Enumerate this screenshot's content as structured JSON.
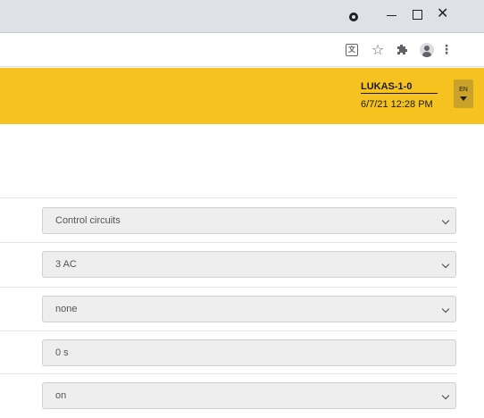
{
  "browser": {
    "toolbar_icons": [
      "translate-icon",
      "star-icon",
      "puzzle-icon",
      "avatar-icon",
      "menu-icon"
    ],
    "menu_glyph": "⋮",
    "star_glyph": "☆",
    "window_controls": {
      "close": "✕"
    }
  },
  "header": {
    "device_name": "LUKAS-1-0",
    "timestamp": "6/7/21 12:28 PM",
    "language": "EN",
    "accent_color": "#f5c220"
  },
  "form": {
    "fields": [
      {
        "value": "Control circuits",
        "type": "select"
      },
      {
        "value": "3 AC",
        "type": "select"
      },
      {
        "value": "none",
        "type": "select"
      },
      {
        "value": "0 s",
        "type": "input"
      },
      {
        "value": "on",
        "type": "select"
      }
    ]
  }
}
